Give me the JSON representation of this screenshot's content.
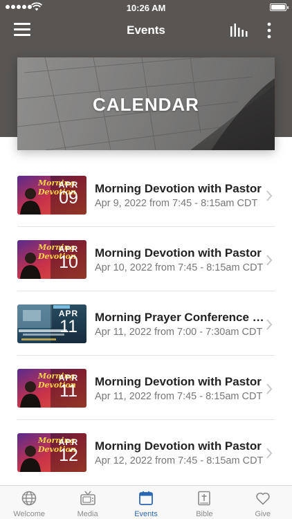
{
  "status_bar": {
    "time": "10:26 AM",
    "signal_bars": 5,
    "battery_level": 1.0
  },
  "nav": {
    "title": "Events",
    "left_icon": "hamburger-menu-icon",
    "right_icons": [
      "bar-chart-icon",
      "more-vertical-icon"
    ]
  },
  "banner": {
    "title": "CALENDAR"
  },
  "events": [
    {
      "thumb_style": "morning-devotion",
      "month": "APR",
      "day": "09",
      "title": "Morning Devotion with Pastor",
      "subtitle": "Apr 9, 2022 from 7:45 - 8:15am CDT"
    },
    {
      "thumb_style": "morning-devotion",
      "month": "APR",
      "day": "10",
      "title": "Morning Devotion with Pastor",
      "subtitle": "Apr 10, 2022 from 7:45 - 8:15am CDT"
    },
    {
      "thumb_style": "prayer-conference",
      "month": "APR",
      "day": "11",
      "title": "Morning Prayer Conference Call",
      "subtitle": "Apr 11, 2022 from 7:00 - 7:30am CDT"
    },
    {
      "thumb_style": "morning-devotion",
      "month": "APR",
      "day": "11",
      "title": "Morning Devotion with Pastor",
      "subtitle": "Apr 11, 2022 from 7:45 - 8:15am CDT"
    },
    {
      "thumb_style": "morning-devotion",
      "month": "APR",
      "day": "12",
      "title": "Morning Devotion with Pastor",
      "subtitle": "Apr 12, 2022 from 7:45 - 8:15am CDT"
    }
  ],
  "tabs": [
    {
      "label": "Welcome",
      "icon": "globe-icon",
      "active": false
    },
    {
      "label": "Media",
      "icon": "tv-icon",
      "active": false
    },
    {
      "label": "Events",
      "icon": "calendar-icon",
      "active": true
    },
    {
      "label": "Bible",
      "icon": "bible-icon",
      "active": false
    },
    {
      "label": "Give",
      "icon": "heart-icon",
      "active": false
    }
  ],
  "colors": {
    "header_bg": "#585553",
    "accent": "#2a68b4",
    "tab_inactive": "#8a8a8a",
    "title_text": "#222222",
    "subtitle_text": "#777777"
  }
}
